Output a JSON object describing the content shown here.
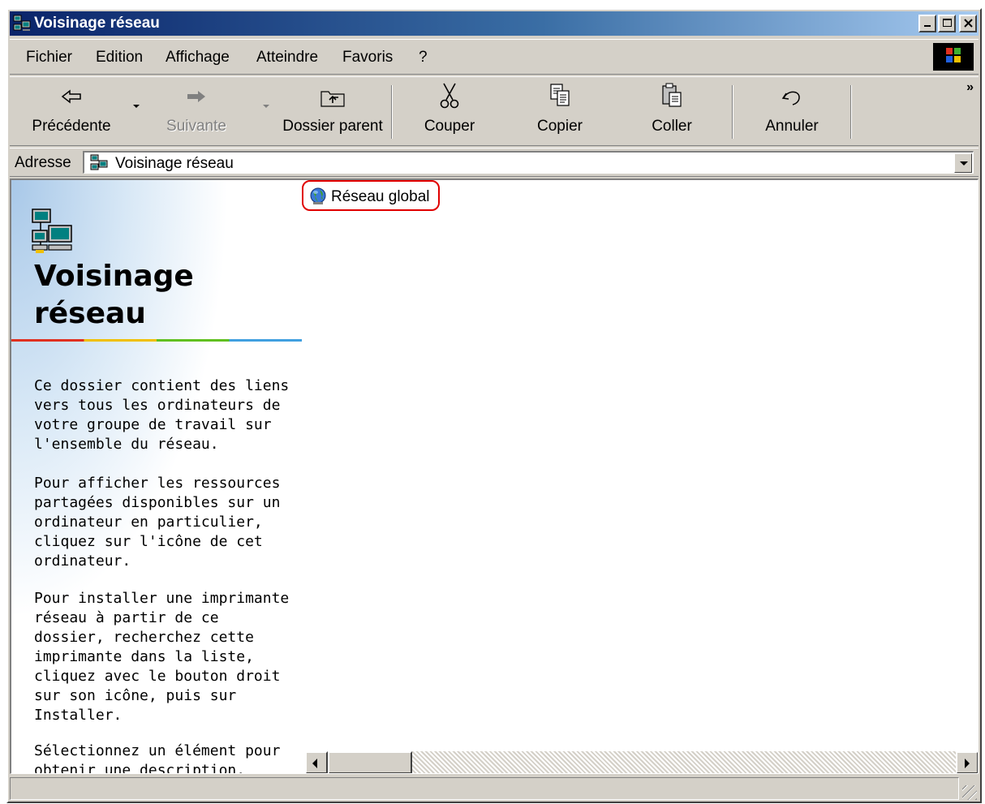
{
  "window": {
    "title": "Voisinage réseau",
    "controls": [
      "minimize",
      "maximize",
      "close"
    ]
  },
  "menu": {
    "items": [
      {
        "label": "Fichier"
      },
      {
        "label": "Edition"
      },
      {
        "label": "Affichage"
      },
      {
        "label": "Atteindre"
      },
      {
        "label": "Favoris"
      },
      {
        "label": "?"
      }
    ]
  },
  "toolbar": {
    "back": "Précédente",
    "forward": "Suivante",
    "up": "Dossier parent",
    "cut": "Couper",
    "copy": "Copier",
    "paste": "Coller",
    "undo": "Annuler",
    "more": "»"
  },
  "address": {
    "label": "Adresse",
    "value": "Voisinage réseau"
  },
  "leftpane": {
    "title_line1": "Voisinage",
    "title_line2": "réseau",
    "paragraphs": [
      "Ce dossier contient des liens vers tous les ordinateurs de votre groupe de travail sur l'ensemble du réseau.",
      "Pour afficher les ressources partagées disponibles sur un ordinateur en particulier, cliquez sur l'icône de cet ordinateur.",
      "Pour installer une imprimante réseau à partir de ce dossier, recherchez cette imprimante dans la liste, cliquez avec le bouton droit sur son icône, puis sur Installer.",
      "Sélectionnez un élément pour obtenir une description."
    ]
  },
  "items": [
    {
      "label": "Réseau global",
      "icon": "globe-network-icon"
    }
  ],
  "status": {
    "text": ""
  },
  "colors": {
    "title_start": "#0a246a",
    "title_end": "#a6caf0",
    "face": "#d4d0c8",
    "highlight_outline": "#e00000"
  }
}
